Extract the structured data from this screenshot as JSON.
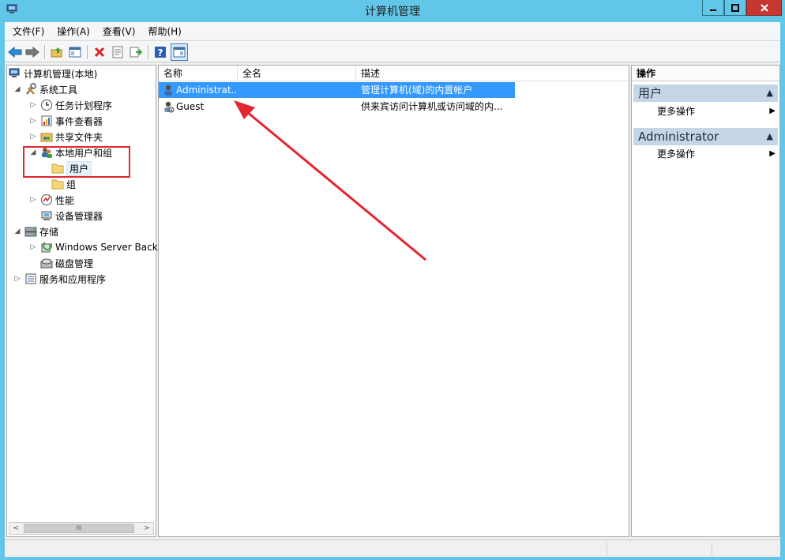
{
  "window": {
    "title": "计算机管理"
  },
  "menu": {
    "items": [
      "文件(F)",
      "操作(A)",
      "查看(V)",
      "帮助(H)"
    ]
  },
  "toolbar": {
    "icons": [
      "back-arrow-icon",
      "forward-arrow-icon",
      "up-folder-icon",
      "show-hide-tree-icon",
      "delete-icon",
      "properties-icon",
      "export-icon",
      "help-icon",
      "action-pane-icon"
    ]
  },
  "tree": {
    "items": [
      {
        "label": "计算机管理(本地)",
        "toggle": "",
        "level": 0,
        "icon": "computer-management-icon"
      },
      {
        "label": "系统工具",
        "toggle": "◢",
        "level": 1,
        "icon": "system-tools-icon"
      },
      {
        "label": "任务计划程序",
        "toggle": "▷",
        "level": 2,
        "icon": "task-scheduler-icon"
      },
      {
        "label": "事件查看器",
        "toggle": "▷",
        "level": 2,
        "icon": "event-viewer-icon"
      },
      {
        "label": "共享文件夹",
        "toggle": "▷",
        "level": 2,
        "icon": "shared-folder-icon"
      },
      {
        "label": "本地用户和组",
        "toggle": "◢",
        "level": 2,
        "icon": "local-users-icon"
      },
      {
        "label": "用户",
        "toggle": "",
        "level": 3,
        "icon": "folder-icon",
        "selected": true
      },
      {
        "label": "组",
        "toggle": "",
        "level": 3,
        "icon": "folder-icon"
      },
      {
        "label": "性能",
        "toggle": "▷",
        "level": 2,
        "icon": "performance-icon"
      },
      {
        "label": "设备管理器",
        "toggle": "",
        "level": 2,
        "icon": "device-manager-icon"
      },
      {
        "label": "存储",
        "toggle": "◢",
        "level": 1,
        "icon": "storage-icon"
      },
      {
        "label": "Windows Server Back",
        "toggle": "▷",
        "level": 2,
        "icon": "backup-icon"
      },
      {
        "label": "磁盘管理",
        "toggle": "",
        "level": 2,
        "icon": "disk-management-icon"
      },
      {
        "label": "服务和应用程序",
        "toggle": "▷",
        "level": 1,
        "icon": "services-icon"
      }
    ]
  },
  "list": {
    "columns": [
      "名称",
      "全名",
      "描述"
    ],
    "rows": [
      {
        "name": "Administrat...",
        "fullname": "",
        "description": "管理计算机(域)的内置帐户",
        "selected": true
      },
      {
        "name": "Guest",
        "fullname": "",
        "description": "供来宾访问计算机或访问域的内..."
      }
    ]
  },
  "actions": {
    "title": "操作",
    "sections": [
      {
        "label": "用户",
        "items": [
          "更多操作"
        ]
      },
      {
        "label": "Administrator",
        "items": [
          "更多操作"
        ]
      }
    ]
  },
  "scrollbar": {
    "thumb_label": "III"
  },
  "colors": {
    "selection": "#3399ff",
    "annotation": "#e3262f",
    "section_header": "#c5d7e7"
  }
}
